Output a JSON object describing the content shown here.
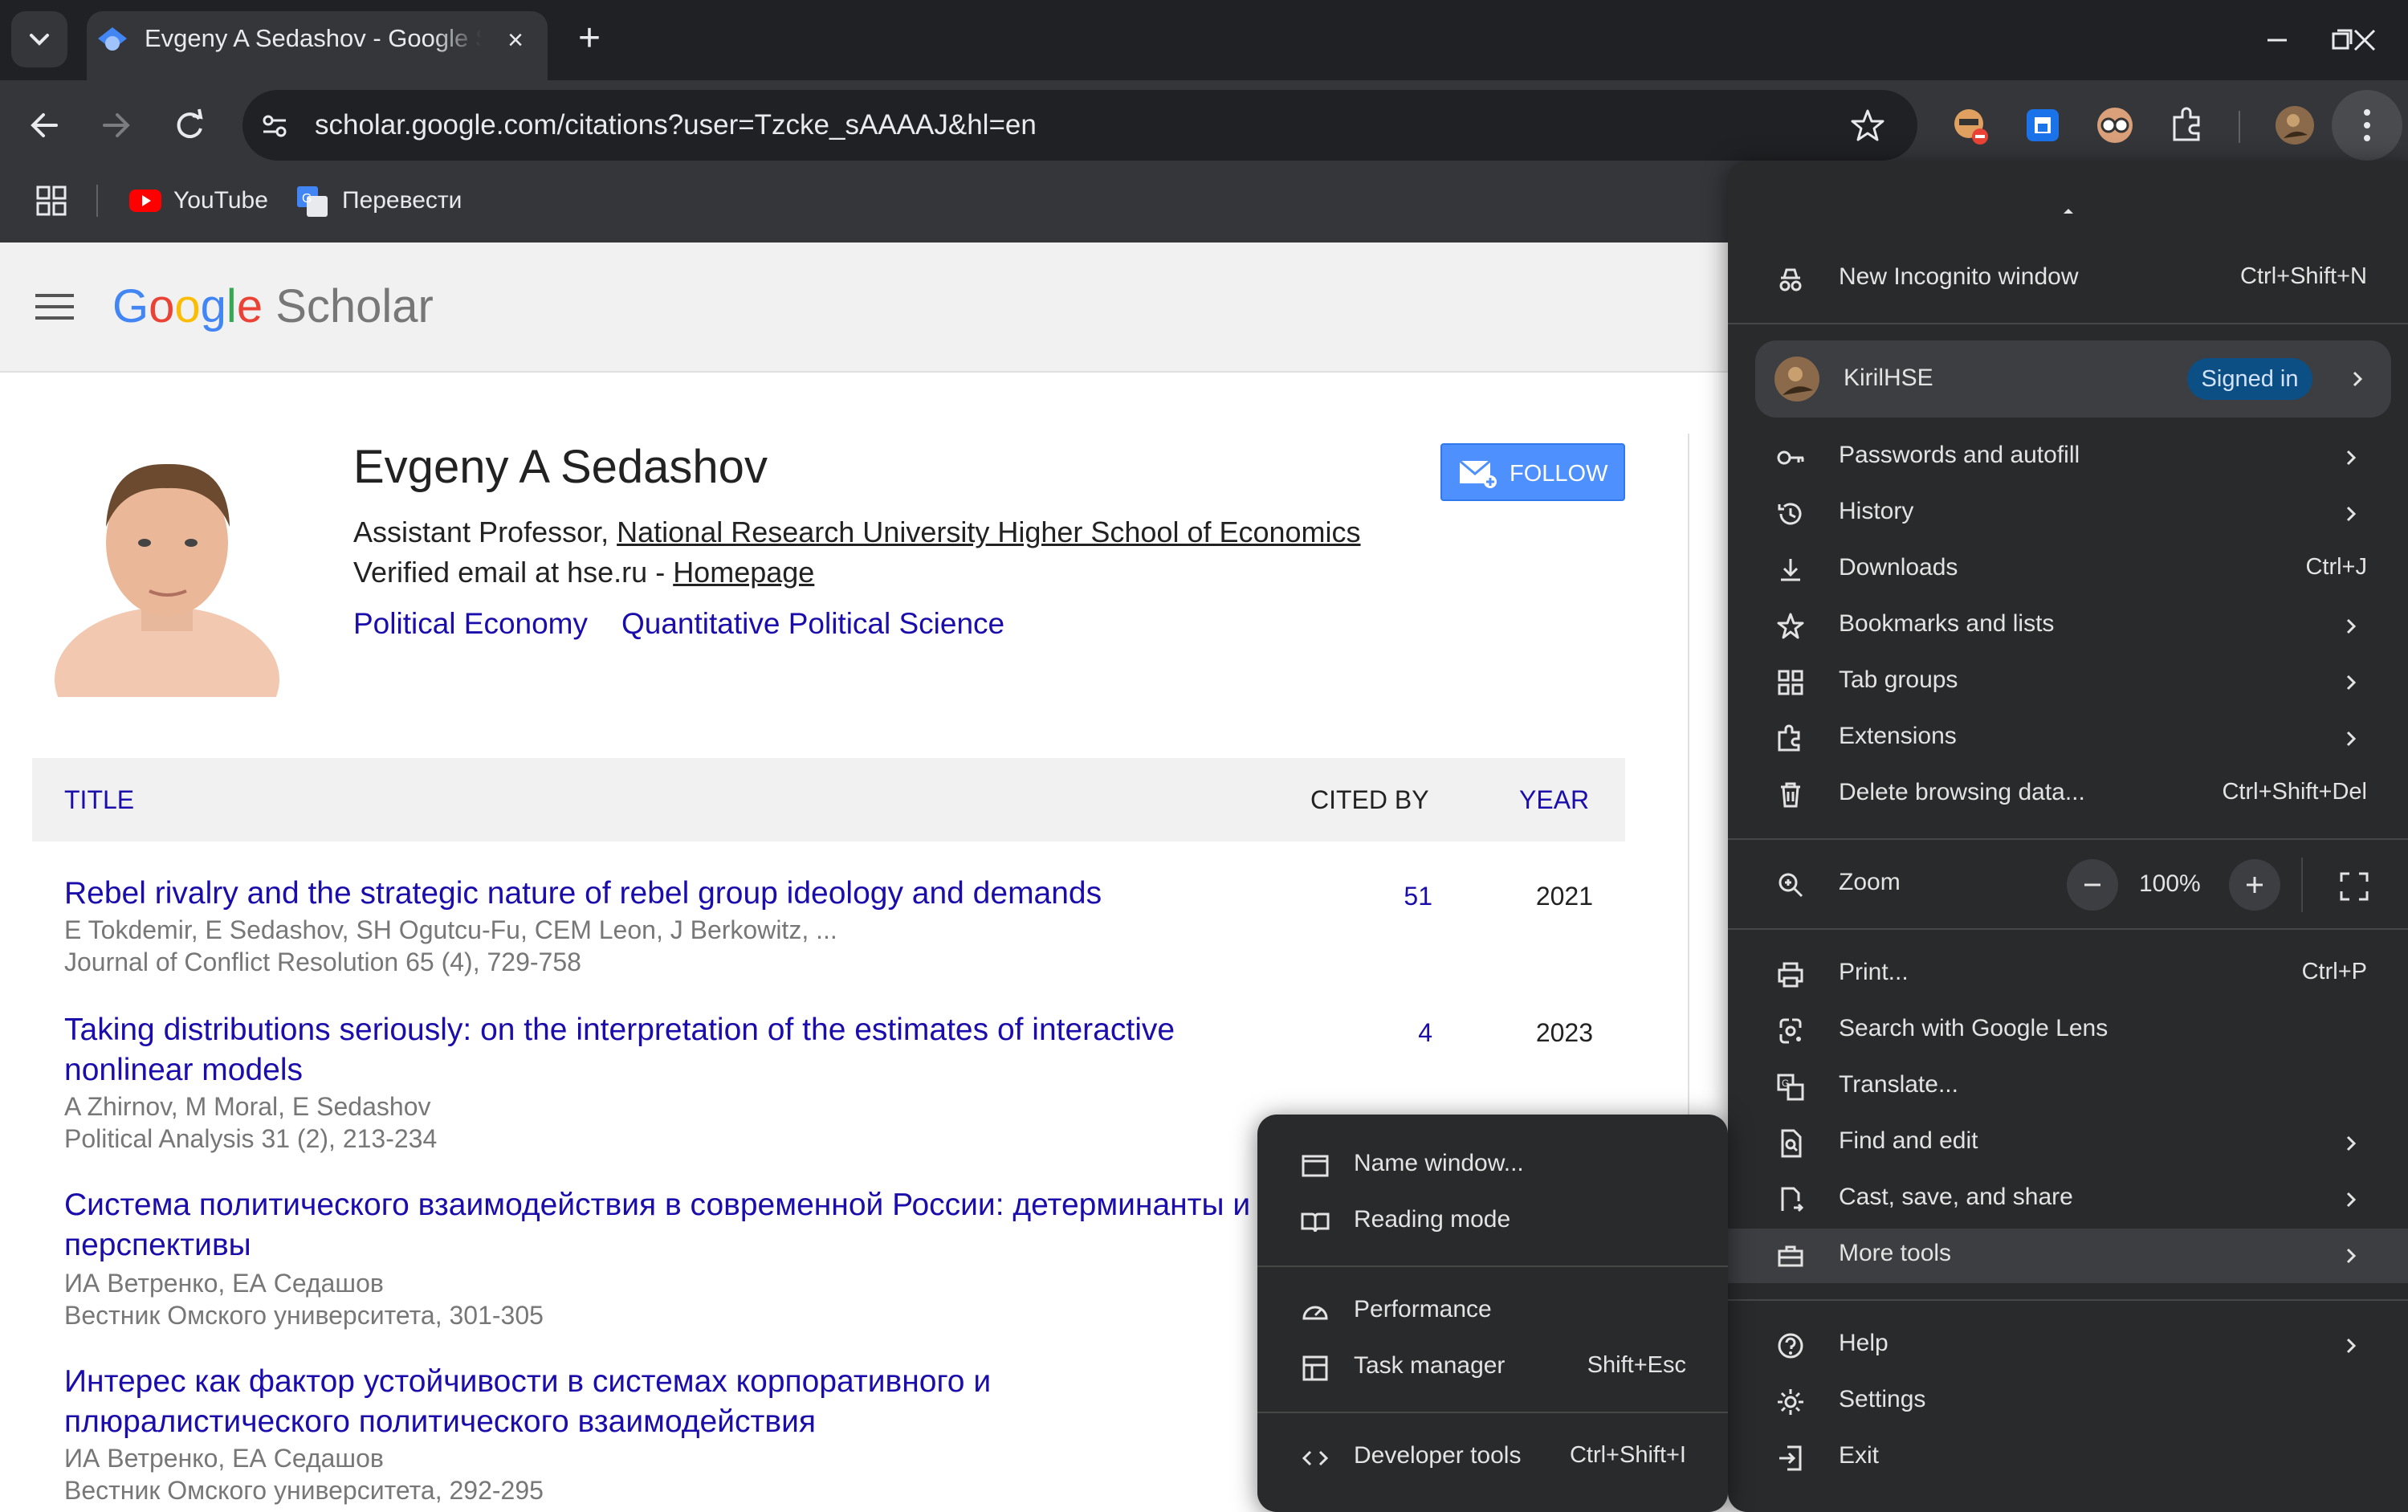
{
  "browser": {
    "tab_title": "Evgeny A Sedashov - Google Scholar",
    "url": "scholar.google.com/citations?user=Tzcke_sAAAAJ&hl=en",
    "bookmarks": [
      {
        "label": "YouTube"
      },
      {
        "label": "Перевести"
      }
    ]
  },
  "scholar": {
    "logo_google": [
      "G",
      "o",
      "o",
      "g",
      "l",
      "e"
    ],
    "logo_scholar": "Scholar",
    "profile": {
      "name": "Evgeny A Sedashov",
      "position_prefix": "Assistant Professor, ",
      "affiliation": "National Research University Higher School of Economics",
      "email_text": "Verified email at hse.ru - ",
      "homepage": "Homepage",
      "topics": [
        "Political Economy",
        "Quantitative Political Science"
      ],
      "follow_label": "FOLLOW"
    },
    "table": {
      "col_title": "TITLE",
      "col_cited": "CITED BY",
      "col_year": "YEAR"
    },
    "papers": [
      {
        "title_lines": [
          "Rebel rivalry and the strategic nature of rebel group ideology and demands"
        ],
        "authors": "E Tokdemir, E Sedashov, SH Ogutcu-Fu, CEM Leon, J Berkowitz, ...",
        "venue": "Journal of Conflict Resolution 65 (4), 729-758",
        "cited": "51",
        "year": "2021"
      },
      {
        "title_lines": [
          "Taking distributions seriously: on the interpretation of the estimates of interactive",
          "nonlinear models"
        ],
        "authors": "A Zhirnov, M Moral, E Sedashov",
        "venue": "Political Analysis 31 (2), 213-234",
        "cited": "4",
        "year": "2023"
      },
      {
        "title_lines": [
          "Система политического взаимодействия в современной России: детерминанты и",
          "перспективы"
        ],
        "authors": "ИА Ветренко, ЕА Седашов",
        "venue": "Вестник Омского университета, 301-305",
        "cited": "",
        "year": ""
      },
      {
        "title_lines": [
          "Интерес как фактор устойчивости в системах корпоративного и",
          "плюралистического политического взаимодействия"
        ],
        "authors": "ИА Ветренко, ЕА Седашов",
        "venue": "Вестник Омского университета, 292-295",
        "cited": "",
        "year": ""
      }
    ]
  },
  "chrome_menu": {
    "items": [
      {
        "label": "New Incognito window",
        "shortcut": "Ctrl+Shift+N",
        "icon": "incognito-icon"
      },
      {
        "label": "KirilHSE",
        "badge": "Signed in",
        "icon": "avatar"
      },
      {
        "label": "Passwords and autofill",
        "icon": "key-icon"
      },
      {
        "label": "History",
        "icon": "history-icon"
      },
      {
        "label": "Downloads",
        "shortcut": "Ctrl+J",
        "icon": "download-icon"
      },
      {
        "label": "Bookmarks and lists",
        "icon": "star-icon"
      },
      {
        "label": "Tab groups",
        "icon": "tab-groups-icon"
      },
      {
        "label": "Extensions",
        "icon": "puzzle-icon"
      },
      {
        "label": "Delete browsing data...",
        "shortcut": "Ctrl+Shift+Del",
        "icon": "trash-icon"
      },
      {
        "label": "Zoom",
        "icon": "zoom-icon"
      },
      {
        "label": "Print...",
        "shortcut": "Ctrl+P",
        "icon": "print-icon"
      },
      {
        "label": "Search with Google Lens",
        "icon": "lens-icon"
      },
      {
        "label": "Translate...",
        "icon": "translate-icon"
      },
      {
        "label": "Find and edit",
        "icon": "find-icon"
      },
      {
        "label": "Cast, save, and share",
        "icon": "cast-icon"
      },
      {
        "label": "More tools",
        "icon": "toolbox-icon"
      },
      {
        "label": "Help",
        "icon": "help-icon"
      },
      {
        "label": "Settings",
        "icon": "gear-icon"
      },
      {
        "label": "Exit",
        "icon": "exit-icon"
      }
    ],
    "zoom_value": "100%"
  },
  "more_tools_menu": {
    "items": [
      {
        "label": "Name window...",
        "icon": "window-icon"
      },
      {
        "label": "Reading mode",
        "icon": "book-icon"
      },
      {
        "label": "Performance",
        "icon": "speedometer-icon"
      },
      {
        "label": "Task manager",
        "shortcut": "Shift+Esc",
        "icon": "task-manager-icon"
      },
      {
        "label": "Developer tools",
        "shortcut": "Ctrl+Shift+I",
        "icon": "code-icon"
      }
    ]
  },
  "colors": {
    "google_blue": "#4285f4",
    "google_red": "#ea4335",
    "google_yellow": "#fbbc05",
    "google_green": "#34a853",
    "scholar_link": "#1a0dab",
    "menu_bg": "#282a2c",
    "signed_in_badge": "#0b4f85"
  }
}
